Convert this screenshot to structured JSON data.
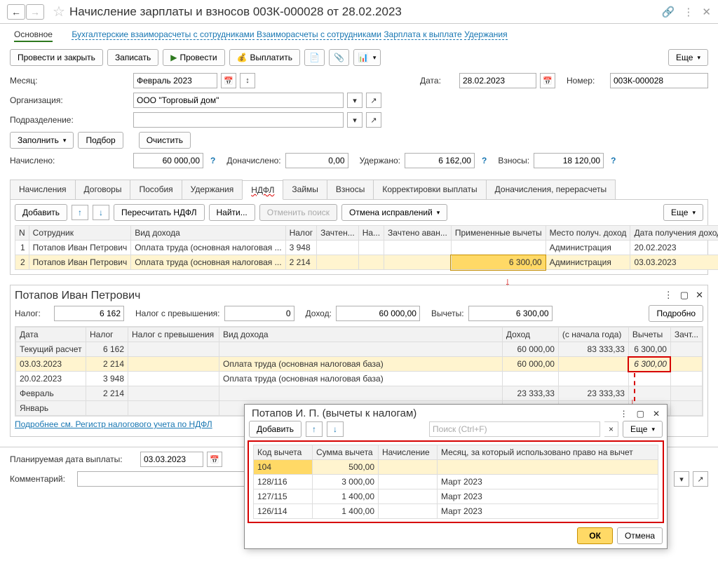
{
  "header": {
    "title": "Начисление зарплаты и взносов 003К-000028 от 28.02.2023"
  },
  "sections": {
    "main": "Основное",
    "l1": "Бухгалтерские взаиморасчеты с сотрудниками",
    "l2": "Взаиморасчеты с сотрудниками",
    "l3": "Зарплата к выплате",
    "l4": "Удержания"
  },
  "toolbar": {
    "post_close": "Провести и закрыть",
    "save": "Записать",
    "post": "Провести",
    "pay": "Выплатить",
    "more": "Еще"
  },
  "form": {
    "month_label": "Месяц:",
    "month": "Февраль 2023",
    "date_label": "Дата:",
    "date": "28.02.2023",
    "number_label": "Номер:",
    "number": "003К-000028",
    "org_label": "Организация:",
    "org": "ООО \"Торговый дом\"",
    "dept_label": "Подразделение:",
    "fill": "Заполнить",
    "select": "Подбор",
    "clear": "Очистить",
    "accrued_label": "Начислено:",
    "accrued": "60 000,00",
    "extra_label": "Доначислено:",
    "extra": "0,00",
    "withheld_label": "Удержано:",
    "withheld": "6 162,00",
    "contrib_label": "Взносы:",
    "contrib": "18 120,00"
  },
  "tabs": {
    "t1": "Начисления",
    "t2": "Договоры",
    "t3": "Пособия",
    "t4": "Удержания",
    "t5": "НДФЛ",
    "t6": "Займы",
    "t7": "Взносы",
    "t8": "Корректировки выплаты",
    "t9": "Доначисления, перерасчеты"
  },
  "subtoolbar": {
    "add": "Добавить",
    "recalc": "Пересчитать НДФЛ",
    "find": "Найти...",
    "cancel_search": "Отменить поиск",
    "cancel_fix": "Отмена исправлений",
    "more": "Еще"
  },
  "main_table": {
    "cols": {
      "n": "N",
      "emp": "Сотрудник",
      "type": "Вид дохода",
      "tax": "Налог",
      "cred": "Зачтен...",
      "na": "На...",
      "credadv": "Зачтено аван...",
      "applied": "Примененные вычеты",
      "place": "Место получ. доход",
      "date": "Дата получения дохода"
    },
    "rows": [
      {
        "n": "1",
        "emp": "Потапов Иван Петрович",
        "type": "Оплата труда (основная налоговая ...",
        "tax": "3 948",
        "applied": "",
        "place": "Администрация",
        "date": "20.02.2023"
      },
      {
        "n": "2",
        "emp": "Потапов Иван Петрович",
        "type": "Оплата труда (основная налоговая ...",
        "tax": "2 214",
        "applied": "6 300,00",
        "place": "Администрация",
        "date": "03.03.2023"
      }
    ]
  },
  "detail": {
    "title": "Потапов Иван Петрович",
    "tax_label": "Налог:",
    "tax": "6 162",
    "excess_label": "Налог с превышения:",
    "excess": "0",
    "income_label": "Доход:",
    "income": "60 000,00",
    "deduct_label": "Вычеты:",
    "deduct": "6 300,00",
    "detail_btn": "Подробно",
    "cols": {
      "date": "Дата",
      "tax": "Налог",
      "excess": "Налог с превышения",
      "type": "Вид дохода",
      "income": "Доход",
      "ytd": "(с начала года)",
      "deduct": "Вычеты",
      "cred": "Зачт..."
    },
    "rows": [
      {
        "date": "Текущий расчет",
        "tax": "6 162",
        "excess": "",
        "type": "",
        "income": "60 000,00",
        "ytd": "83 333,33",
        "deduct": "6 300,00",
        "cls": "subtotal"
      },
      {
        "date": "03.03.2023",
        "tax": "2 214",
        "excess": "",
        "type": "Оплата труда (основная налоговая база)",
        "income": "60 000,00",
        "ytd": "",
        "deduct": "6 300,00",
        "cls": "hl-red"
      },
      {
        "date": "20.02.2023",
        "tax": "3 948",
        "excess": "",
        "type": "Оплата труда (основная налоговая база)",
        "income": "",
        "ytd": "",
        "deduct": "",
        "cls": ""
      },
      {
        "date": "Февраль",
        "tax": "2 214",
        "excess": "",
        "type": "",
        "income": "23 333,33",
        "ytd": "23 333,33",
        "deduct": "",
        "cls": "subtotal"
      },
      {
        "date": "Январь",
        "tax": "",
        "excess": "",
        "type": "",
        "income": "",
        "ytd": "",
        "deduct": "",
        "cls": "subtotal"
      }
    ],
    "link": "Подробнее см. Регистр налогового учета по НДФЛ"
  },
  "floating": {
    "title": "Потапов И. П. (вычеты к налогам)",
    "add": "Добавить",
    "search_placeholder": "Поиск (Ctrl+F)",
    "more": "Еще",
    "cols": {
      "code": "Код вычета",
      "sum": "Сумма вычета",
      "accr": "Начисление",
      "month": "Месяц, за который использовано право на вычет"
    },
    "rows": [
      {
        "code": "104",
        "sum": "500,00",
        "accr": "",
        "month": ""
      },
      {
        "code": "128/116",
        "sum": "3 000,00",
        "accr": "",
        "month": "Март 2023"
      },
      {
        "code": "127/115",
        "sum": "1 400,00",
        "accr": "",
        "month": "Март 2023"
      },
      {
        "code": "126/114",
        "sum": "1 400,00",
        "accr": "",
        "month": "Март 2023"
      }
    ],
    "ok": "ОК",
    "cancel": "Отмена"
  },
  "bottom": {
    "plan_label": "Планируемая дата выплаты:",
    "plan_date": "03.03.2023",
    "comment_label": "Комментарий:"
  }
}
